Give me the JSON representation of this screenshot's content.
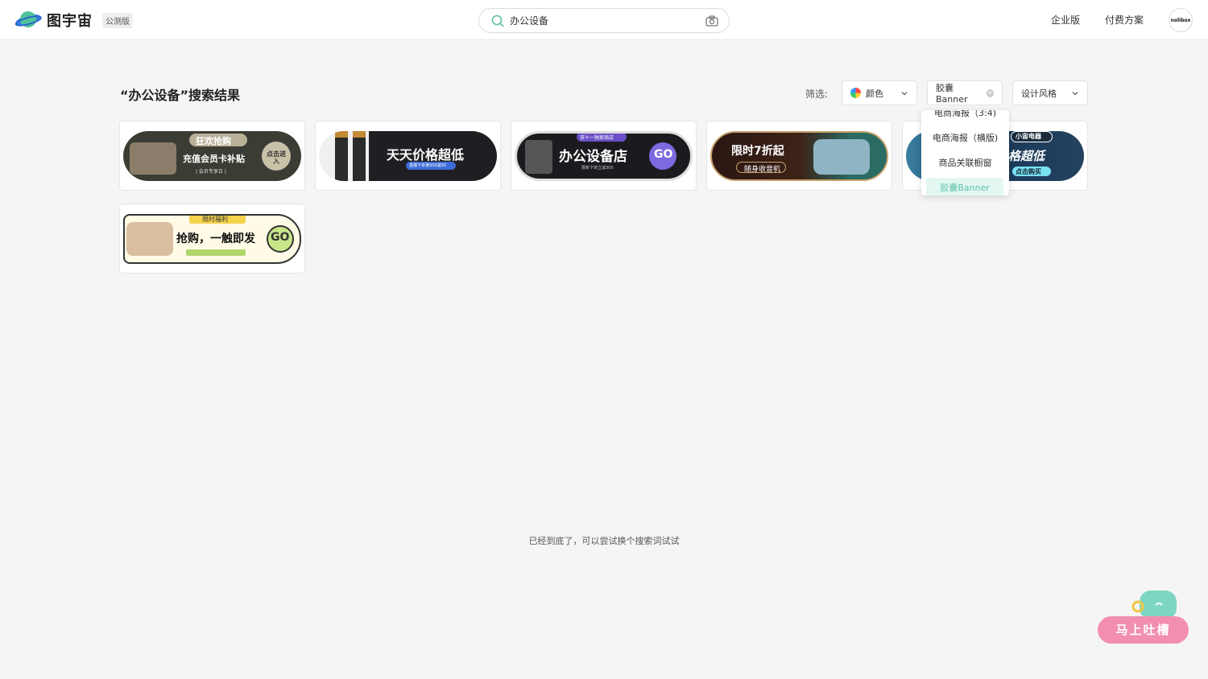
{
  "header": {
    "logo_text": "图宇宙",
    "beta_label": "公测版",
    "search_value": "办公设备",
    "nav": [
      "企业版",
      "付费方案"
    ],
    "avatar_text": "nolibox"
  },
  "results": {
    "title": "“办公设备”搜索结果",
    "filter_label": "筛选:",
    "filters": {
      "color": "颜色",
      "type": "胶囊Banner",
      "style": "设计风格"
    }
  },
  "dropdown": {
    "items": [
      "电商海报（3:4)",
      "电商海报（横版)",
      "商品关联橱窗",
      "胶囊Banner"
    ],
    "active_index": 3
  },
  "cards": [
    {
      "title": "充值会员卡补贴",
      "tag": "狂欢抢购",
      "sub": "| 会员专享日 |",
      "cta": "点击进入"
    },
    {
      "title": "天天价格超低",
      "sub": "直播下单满300减30"
    },
    {
      "title": "办公设备店",
      "tag": "双十一独家商店",
      "sub": "限新下单立减300",
      "cta": "GO"
    },
    {
      "title": "限时7折起",
      "sub": "随身收音机"
    },
    {
      "title": "价格超低",
      "tag": "小宙电器",
      "cta": "点击购买"
    },
    {
      "title": "抢购，一触即发",
      "tag": "限时福利",
      "cta": "GO"
    }
  ],
  "footer": {
    "end_text": "已经到底了，可以尝试换个搜索词试试",
    "feedback_label": "马上吐槽"
  },
  "colors": {
    "accent": "#5fc1a6",
    "feedback": "#f28fb0"
  }
}
